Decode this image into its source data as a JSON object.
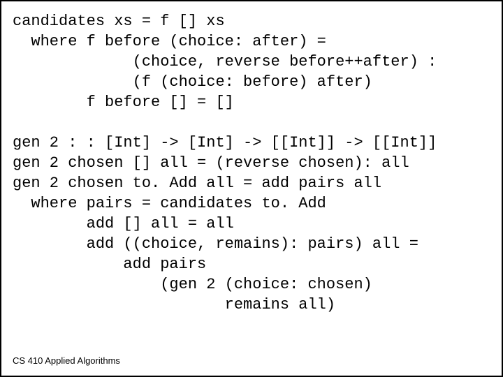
{
  "code": {
    "l1": "candidates xs = f [] xs",
    "l2": "  where f before (choice: after) =",
    "l3": "             (choice, reverse before++after) :",
    "l4": "             (f (choice: before) after)",
    "l5": "        f before [] = []",
    "l6": "",
    "l7": "gen 2 : : [Int] -> [Int] -> [[Int]] -> [[Int]]",
    "l8": "gen 2 chosen [] all = (reverse chosen): all",
    "l9": "gen 2 chosen to. Add all = add pairs all",
    "l10": "  where pairs = candidates to. Add",
    "l11": "        add [] all = all",
    "l12": "        add ((choice, remains): pairs) all =",
    "l13": "            add pairs",
    "l14": "                (gen 2 (choice: chosen)",
    "l15": "                       remains all)"
  },
  "footer": "CS 410  Applied Algorithms"
}
